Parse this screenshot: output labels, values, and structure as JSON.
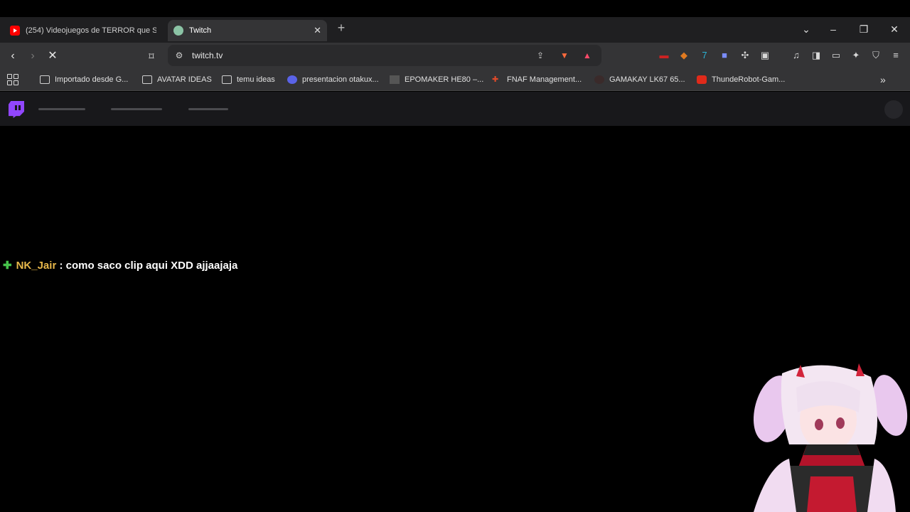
{
  "browser": {
    "tabs": [
      {
        "title": "(254) Videojuegos de TERROR que S",
        "favicon": "youtube-icon"
      },
      {
        "title": "Twitch",
        "favicon": "twitch-icon",
        "active": true
      }
    ],
    "new_tab_label": "+",
    "url": "twitch.tv"
  },
  "bookmarks": [
    {
      "label": "Importado desde G...",
      "icon": "folder-icon"
    },
    {
      "label": "AVATAR IDEAS",
      "icon": "folder-icon"
    },
    {
      "label": "temu ideas",
      "icon": "folder-icon"
    },
    {
      "label": "presentacion otakux...",
      "icon": "site-icon"
    },
    {
      "label": "EPOMAKER HE80 –...",
      "icon": "site-icon"
    },
    {
      "label": "FNAF Management...",
      "icon": "site-icon"
    },
    {
      "label": "GAMAKAY LK67 65...",
      "icon": "site-icon"
    },
    {
      "label": "ThundeRobot-Gam...",
      "icon": "site-icon"
    }
  ],
  "chat": {
    "username": "NK_Jair",
    "separator": " : ",
    "message": "como saco clip aqui XDD ajjaajaja"
  },
  "colors": {
    "twitch_purple": "#9146ff",
    "username": "#e8b84a",
    "badge": "#46c34b"
  }
}
